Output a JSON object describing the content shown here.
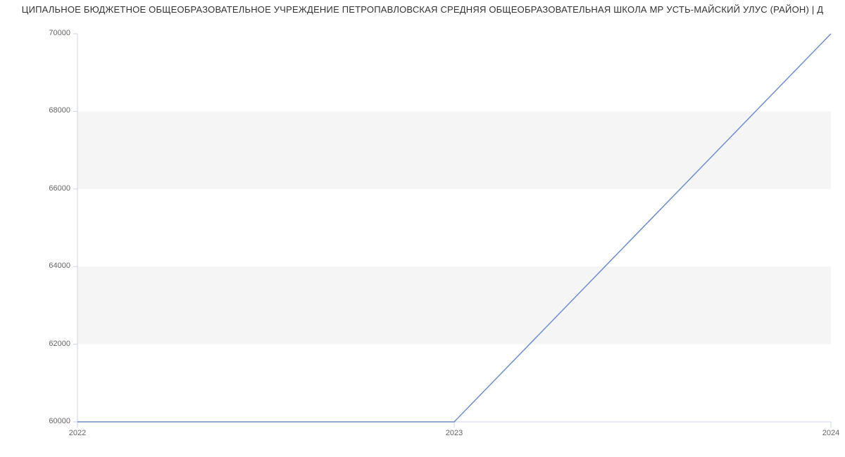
{
  "chart_data": {
    "type": "line",
    "title": "ЦИПАЛЬНОЕ БЮДЖЕТНОЕ ОБЩЕОБРАЗОВАТЕЛЬНОЕ УЧРЕЖДЕНИЕ ПЕТРОПАВЛОВСКАЯ СРЕДНЯЯ ОБЩЕОБРАЗОВАТЕЛЬНАЯ ШКОЛА МР УСТЬ-МАЙСКИЙ УЛУС (РАЙОН) | Д",
    "x": [
      2022,
      2023,
      2024
    ],
    "values": [
      60000,
      60000,
      70000
    ],
    "x_ticks": [
      "2022",
      "2023",
      "2024"
    ],
    "y_ticks": [
      "60000",
      "62000",
      "64000",
      "66000",
      "68000",
      "70000"
    ],
    "xlim": [
      2022,
      2024
    ],
    "ylim": [
      60000,
      70000
    ],
    "line_color": "#6f8ecb",
    "axis_color": "#ccd6eb",
    "band_color": "#f5f5f5"
  },
  "layout": {
    "plot_left": 110,
    "plot_right": 1180,
    "plot_top": 48,
    "plot_bottom": 600
  }
}
